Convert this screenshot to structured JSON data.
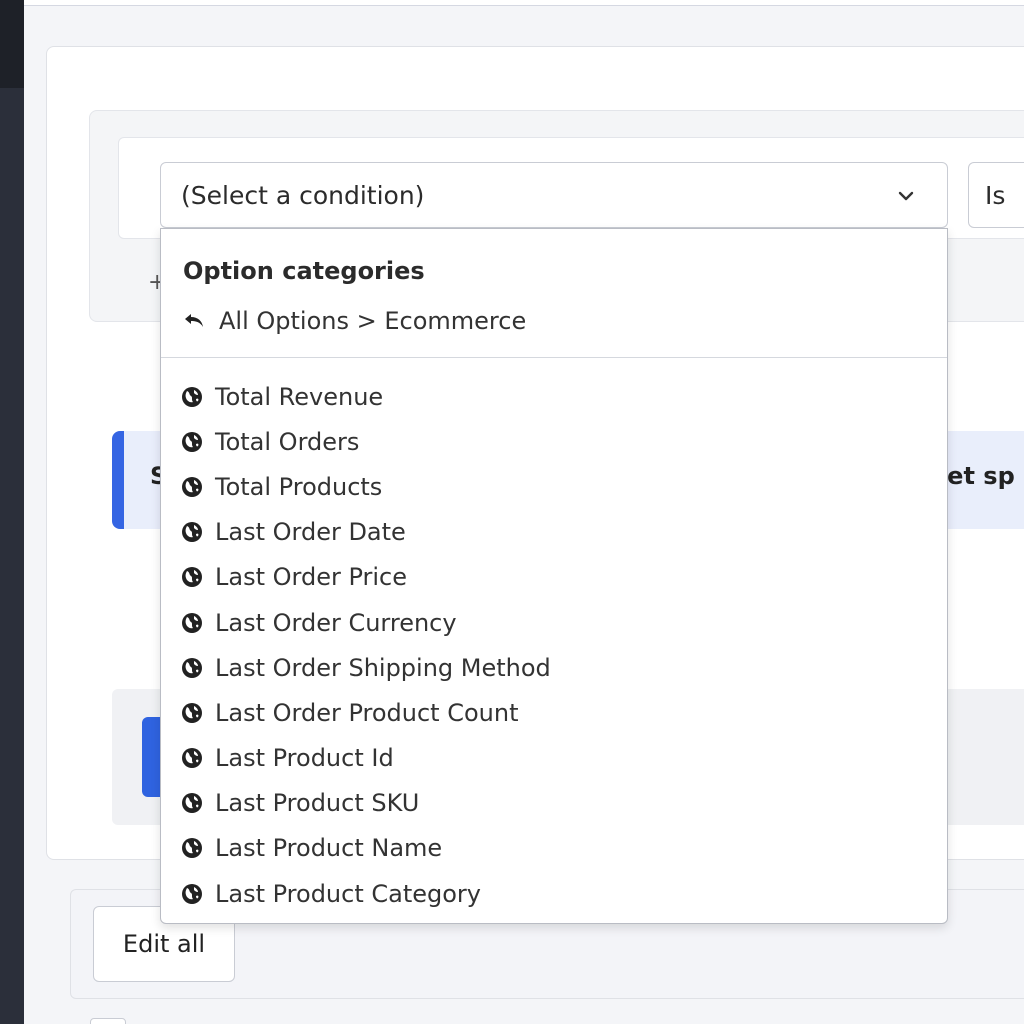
{
  "condition_select": {
    "placeholder_text": "(Select a condition)"
  },
  "operator_select": {
    "value": "Is"
  },
  "dropdown": {
    "heading": "Option categories",
    "breadcrumb": "All Options > Ecommerce",
    "items": [
      "Total Revenue",
      "Total Orders",
      "Total Products",
      "Last Order Date",
      "Last Order Price",
      "Last Order Currency",
      "Last Order Shipping Method",
      "Last Order Product Count",
      "Last Product Id",
      "Last Product SKU",
      "Last Product Name",
      "Last Product Category"
    ]
  },
  "info_banner": {
    "left_text": "S",
    "right_text": "get sp"
  },
  "footer": {
    "edit_all_label": "Edit all"
  },
  "plus_hint": "+",
  "icons": {
    "item_icon": "globe-icon",
    "back_icon": "reply-arrow-icon",
    "select_icon": "chevron-down-icon"
  },
  "colors": {
    "accent": "#3565e3",
    "banner_bg": "#e9eefb",
    "rail": "#2b2f3a"
  }
}
